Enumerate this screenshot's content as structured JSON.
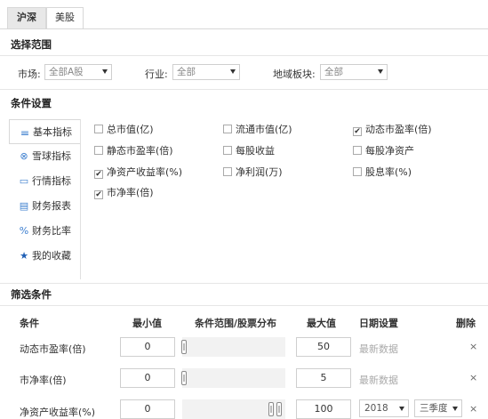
{
  "tabs": {
    "shhs": "沪深",
    "us": "美股"
  },
  "scope": {
    "title": "选择范围",
    "market_label": "市场:",
    "market_value": "全部A股",
    "industry_label": "行业:",
    "industry_value": "全部",
    "region_label": "地域板块:",
    "region_value": "全部"
  },
  "conditions": {
    "title": "条件设置",
    "nav": [
      {
        "icon": "𝍢",
        "label": "基本指标"
      },
      {
        "icon": "⊗",
        "label": "雪球指标"
      },
      {
        "icon": "▭",
        "label": "行情指标"
      },
      {
        "icon": "▤",
        "label": "财务报表"
      },
      {
        "icon": "%",
        "label": "财务比率"
      },
      {
        "icon": "★",
        "label": "我的收藏"
      }
    ],
    "checkboxes": [
      {
        "label": "总市值(亿)",
        "checked": false
      },
      {
        "label": "流通市值(亿)",
        "checked": false
      },
      {
        "label": "动态市盈率(倍)",
        "checked": true
      },
      {
        "label": "静态市盈率(倍)",
        "checked": false
      },
      {
        "label": "每股收益",
        "checked": false
      },
      {
        "label": "每股净资产",
        "checked": false
      },
      {
        "label": "净资产收益率(%)",
        "checked": true
      },
      {
        "label": "净利润(万)",
        "checked": false
      },
      {
        "label": "股息率(%)",
        "checked": false
      },
      {
        "label": "市净率(倍)",
        "checked": true
      }
    ]
  },
  "filter": {
    "title": "筛选条件",
    "headers": {
      "condition": "条件",
      "min": "最小值",
      "range": "条件范围/股票分布",
      "max": "最大值",
      "date": "日期设置",
      "delete": "删除"
    },
    "rows": [
      {
        "label": "动态市盈率(倍)",
        "min": "0",
        "max": "50",
        "date_placeholder": "最新数据",
        "delete": "×"
      },
      {
        "label": "市净率(倍)",
        "min": "0",
        "max": "5",
        "date_placeholder": "最新数据",
        "delete": "×"
      },
      {
        "label": "净资产收益率(%)",
        "min": "0",
        "max": "100",
        "year": "2018",
        "quarter": "三季度",
        "delete": "×"
      }
    ]
  }
}
